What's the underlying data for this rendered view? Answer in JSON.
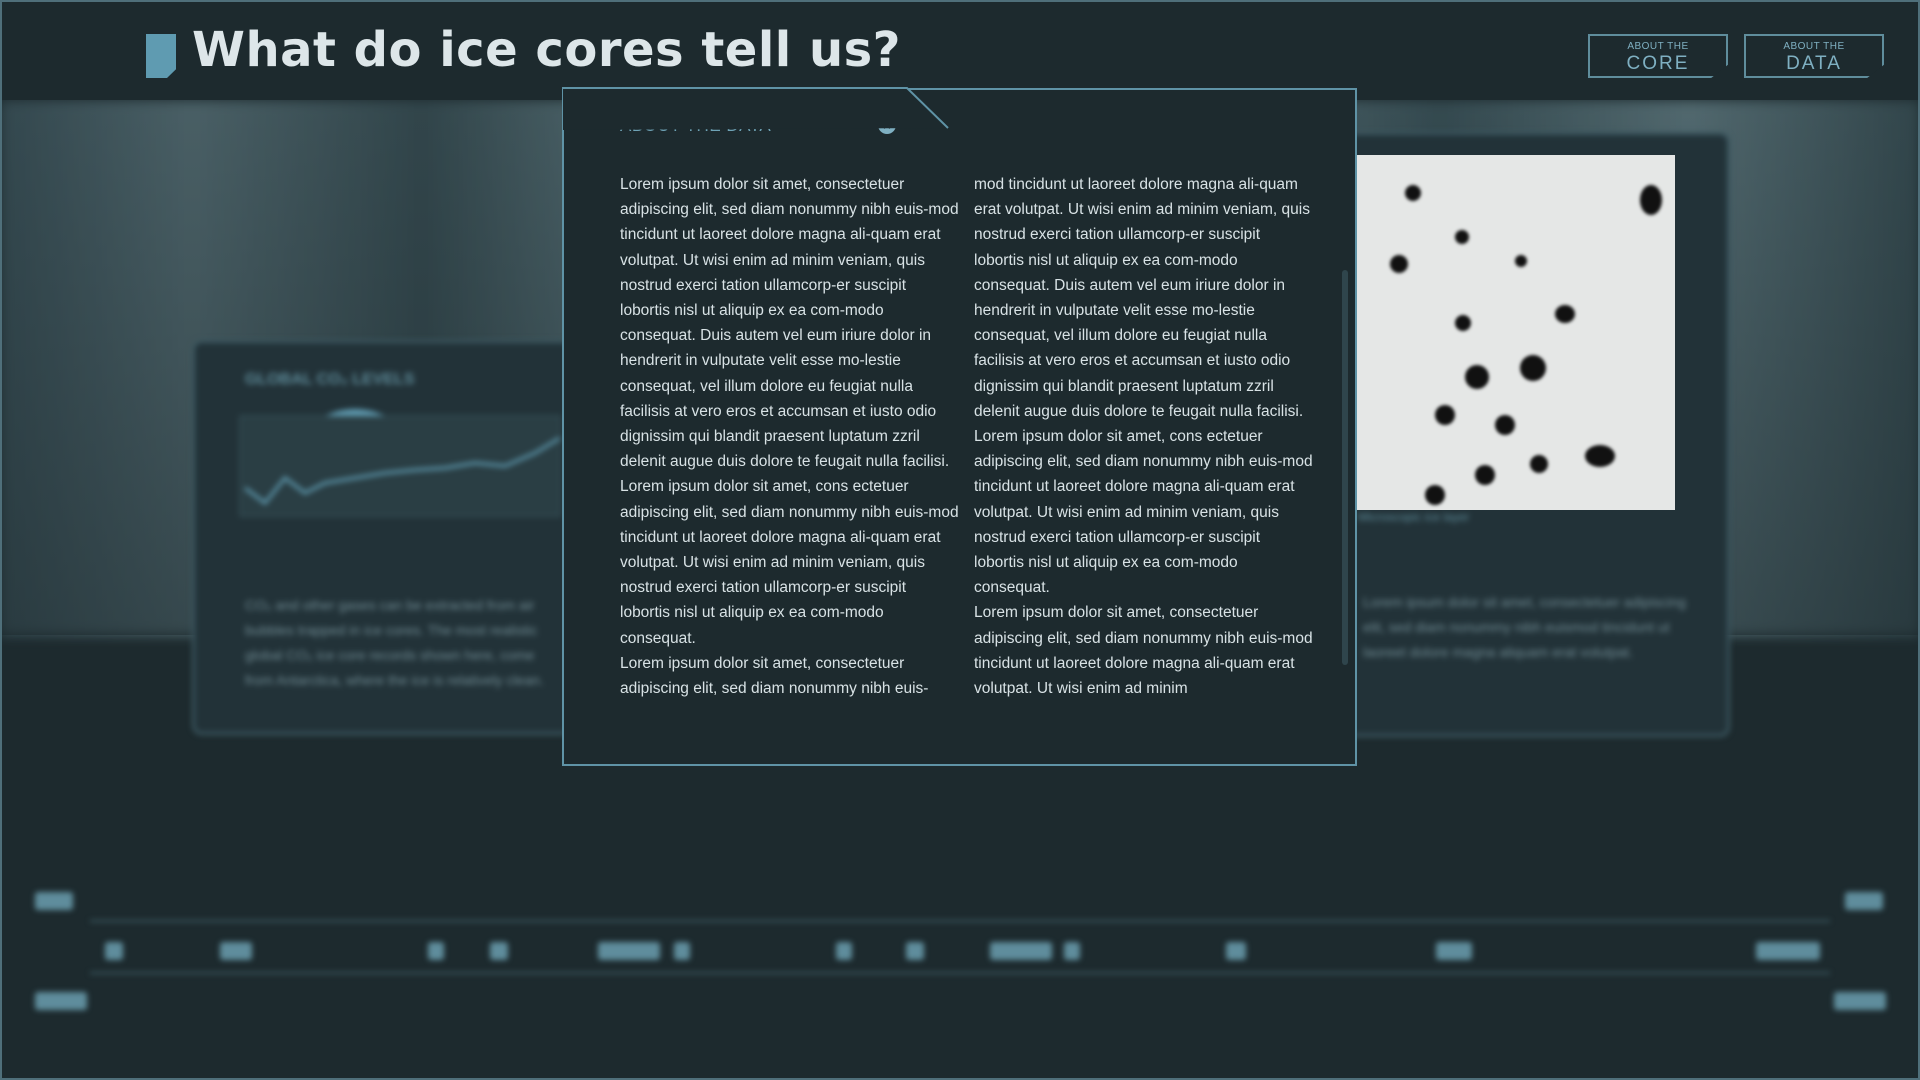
{
  "header": {
    "title": "What do ice cores tell us?",
    "buttons": [
      {
        "small": "ABOUT THE",
        "big": "CORE"
      },
      {
        "small": "ABOUT THE",
        "big": "DATA"
      }
    ]
  },
  "background": {
    "left_card": {
      "title": "GLOBAL CO₂ LEVELS",
      "text": "CO₂ and other gases can be extracted from air bubbles trapped in ice cores. The most realistic global CO₂ ice core records shown here, come from Antarctica, where the ice is relatively clean."
    },
    "right_card": {
      "caption": "Microscopic ice layer",
      "text": "Lorem ipsum dolor sit amet, consectetuer adipiscing elit, sed diam nonummy nibh euismod tincidunt ut laoreet dolore magna aliquam erat volutpat."
    }
  },
  "modal": {
    "heading": "ABOUT THE DATA",
    "close_icon": "close-icon",
    "column1": [
      "Lorem ipsum dolor sit amet, consectetuer adipiscing elit, sed diam nonummy nibh euis-mod tincidunt ut laoreet dolore magna ali-quam erat volutpat. Ut wisi enim ad minim veniam, quis nostrud exerci tation ullamcorp-er suscipit lobortis nisl ut aliquip ex ea com-modo consequat. Duis autem vel eum iriure dolor in hendrerit in vulputate velit esse mo-lestie consequat, vel illum dolore eu feugiat nulla facilisis at vero eros et accumsan et iusto odio dignissim qui blandit praesent luptatum zzril delenit augue duis dolore te feugait nulla facilisi.",
      "Lorem ipsum dolor sit amet, cons ectetuer adipiscing elit, sed diam nonummy nibh euis-mod tincidunt ut laoreet dolore magna ali-quam erat volutpat. Ut wisi enim ad minim veniam, quis nostrud exerci tation ullamcorp-er suscipit lobortis nisl ut aliquip ex ea com-modo consequat.",
      "Lorem ipsum dolor sit amet, consectetuer adipiscing elit, sed diam nonummy nibh euis-"
    ],
    "column2": [
      "mod tincidunt ut laoreet dolore magna ali-quam erat volutpat. Ut wisi enim ad minim veniam, quis nostrud exerci tation ullamcorp-er suscipit lobortis nisl ut aliquip ex ea com-modo consequat. Duis autem vel eum iriure dolor in hendrerit in vulputate velit esse mo-lestie consequat, vel illum dolore eu feugiat nulla facilisis at vero eros et accumsan et iusto odio dignissim qui blandit praesent luptatum zzril delenit augue duis dolore te feugait nulla facilisi.",
      "Lorem ipsum dolor sit amet, cons ectetuer adipiscing elit, sed diam nonummy nibh euis-mod tincidunt ut laoreet dolore magna ali-quam erat volutpat. Ut wisi enim ad minim veniam, quis nostrud exerci tation ullamcorp-er suscipit lobortis nisl ut aliquip ex ea com-modo consequat.",
      "Lorem ipsum dolor sit amet, consectetuer adipiscing elit, sed diam nonummy nibh euis-mod tincidunt ut laoreet dolore magna ali-quam erat volutpat. Ut wisi enim ad minim"
    ]
  },
  "colors": {
    "background": "#1d2a2e",
    "accent": "#5f9bb1",
    "modal_border": "#5f93a6",
    "text": "#d8e2e5"
  }
}
